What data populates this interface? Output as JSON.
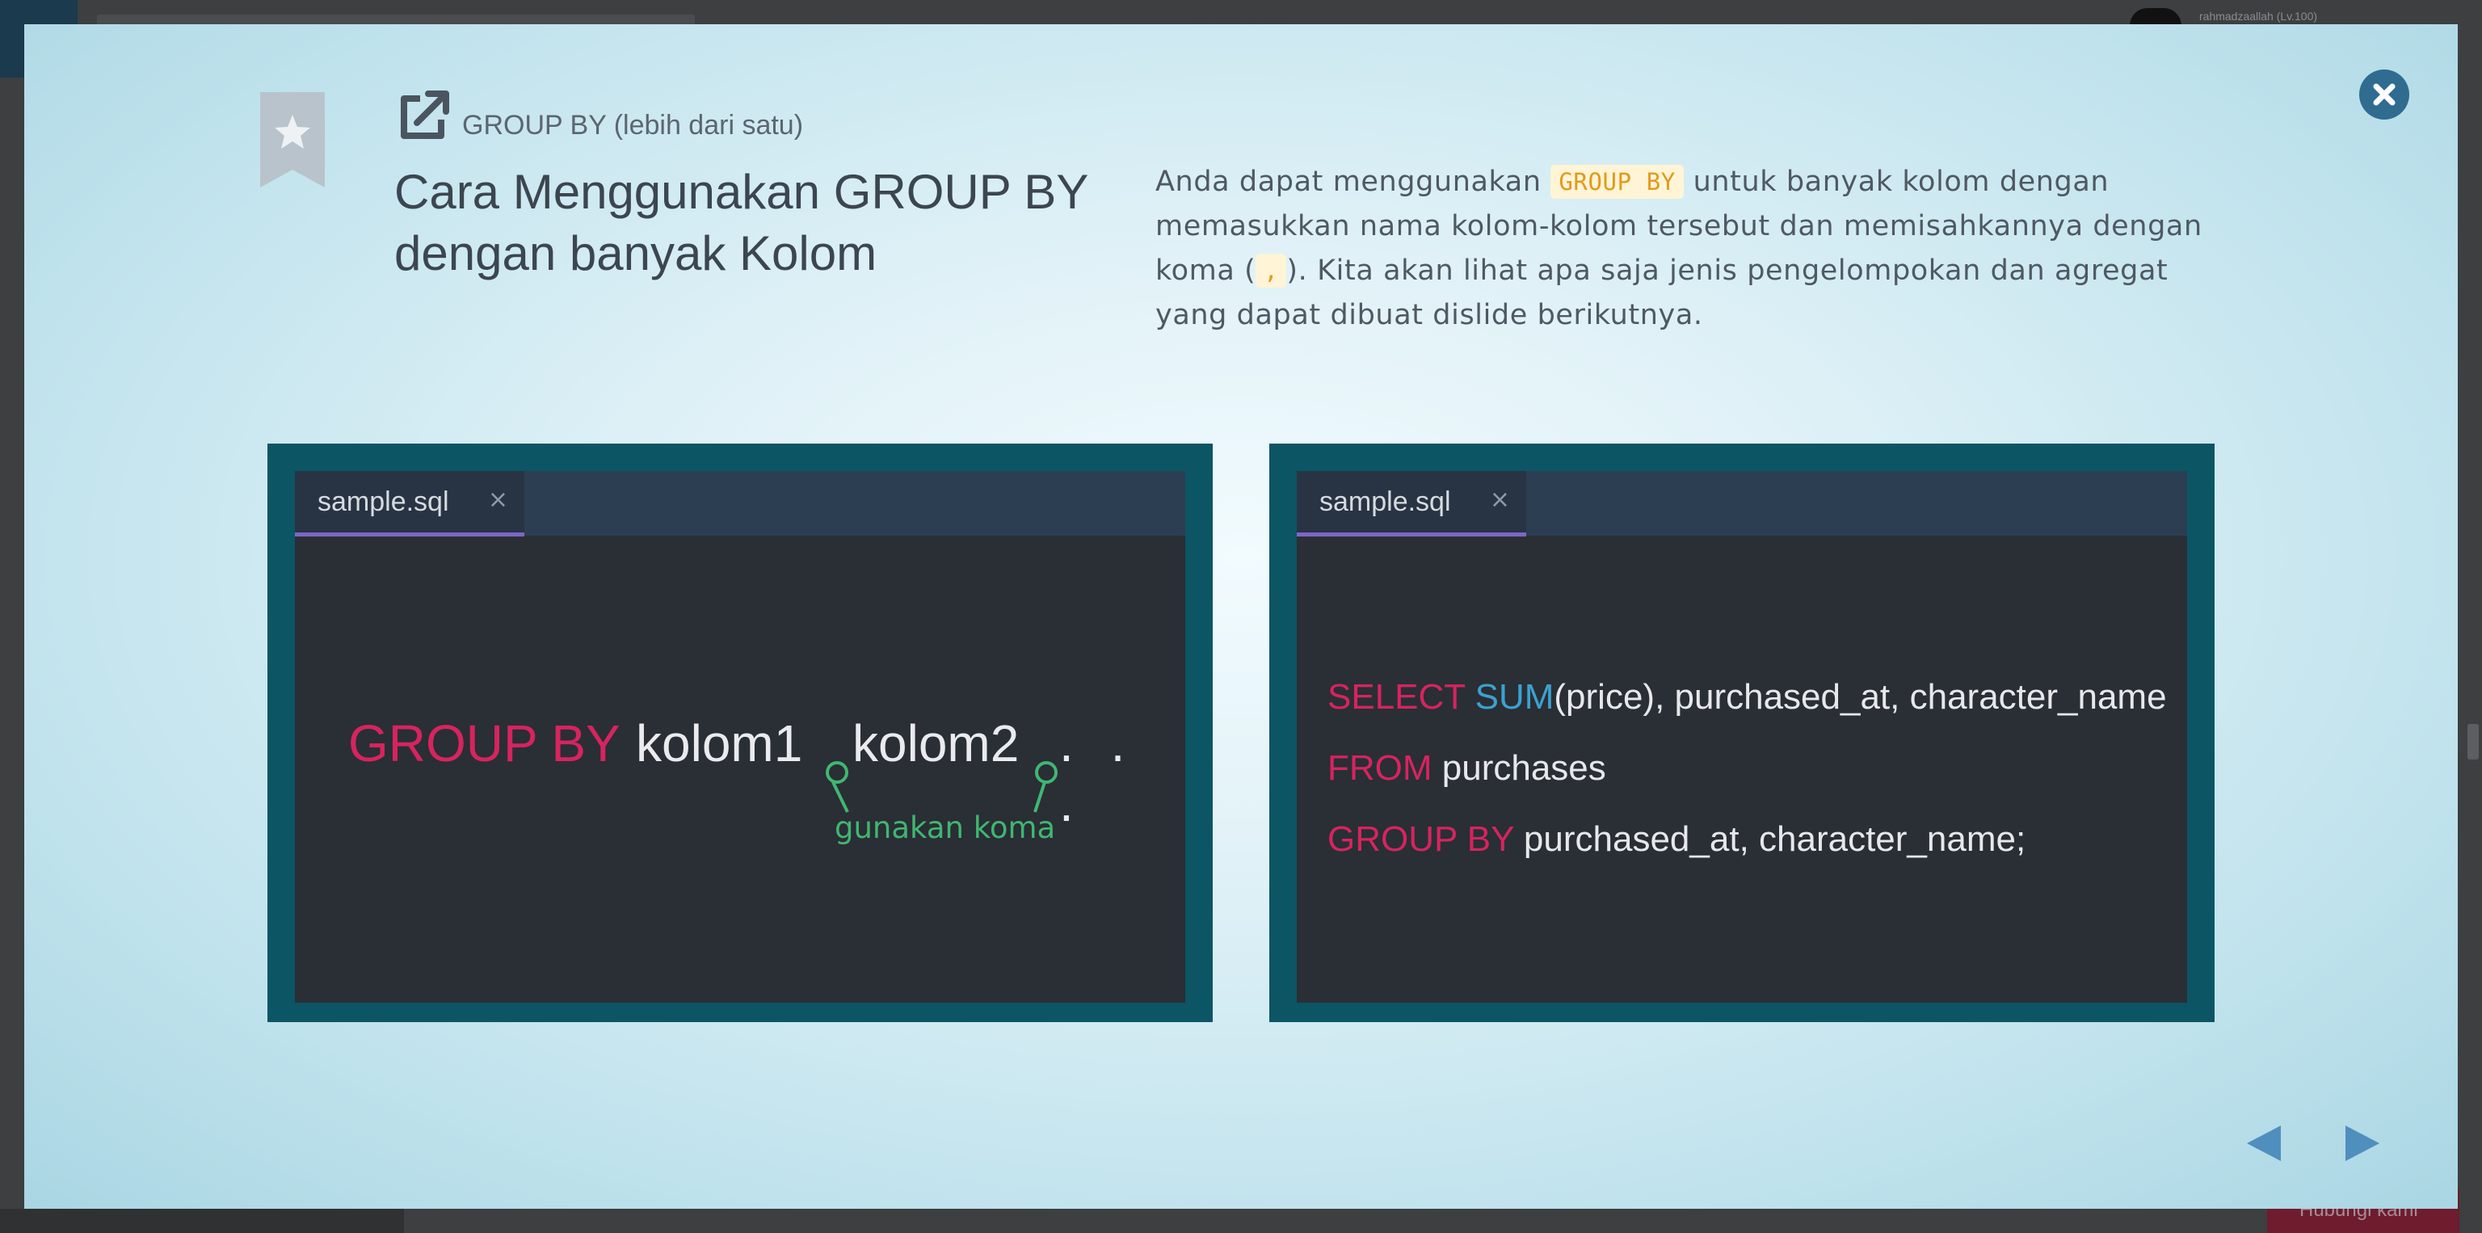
{
  "background": {
    "user_text": "rahmadzaallah (Lv.100)",
    "bottom_button": "Hubungi kami"
  },
  "modal": {
    "subtitle": "GROUP BY (lebih dari satu)",
    "title": "Cara Menggunakan GROUP BY dengan banyak Kolom",
    "description": {
      "part1": "Anda dapat menggunakan ",
      "code1": "GROUP BY",
      "part2": " untuk banyak kolom dengan memasukkan nama kolom-kolom tersebut dan memisahkannya dengan koma (",
      "code2": ",",
      "part3": "). Kita akan lihat apa saja jenis pengelompokan dan agregat yang dapat dibuat dislide berikutnya."
    },
    "left_panel": {
      "tab_label": "sample.sql",
      "tab_close": "×",
      "keyword": "GROUP BY",
      "col1": "kolom1",
      "col2": "kolom2",
      "dots": ". . .",
      "hint": "gunakan koma"
    },
    "right_panel": {
      "tab_label": "sample.sql",
      "tab_close": "×",
      "line1": {
        "kw": "SELECT",
        "fn": "SUM",
        "rest": "(price), purchased_at, character_name"
      },
      "line2": {
        "kw": "FROM",
        "rest": "purchases"
      },
      "line3": {
        "kw": "GROUP BY",
        "rest": "purchased_at, character_name;"
      }
    },
    "colors": {
      "keyword": "#d6245e",
      "function": "#3ba2cf",
      "hint": "#3fb771",
      "panel_frame": "#0b5565",
      "tab_underline": "#7d66c7",
      "close_button": "#2f6c90",
      "nav_arrow": "#4f8fbe"
    },
    "icons": [
      "bookmark-star-icon",
      "external-link-icon",
      "close-icon",
      "prev-arrow-icon",
      "next-arrow-icon"
    ]
  }
}
